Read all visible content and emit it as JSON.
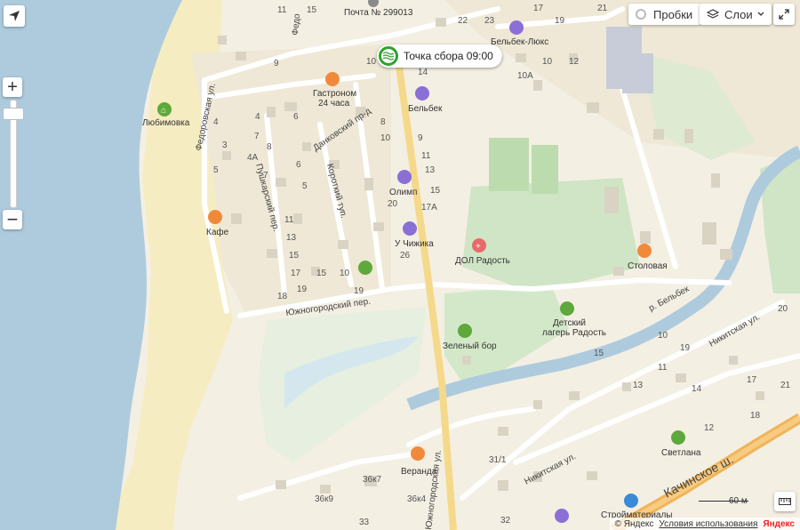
{
  "controls": {
    "traffic_label": "Пробки",
    "layers_label": "Слои",
    "zoom_in": "+",
    "zoom_out": "−"
  },
  "marker": {
    "label": "Точка сбора 09:00",
    "color": "#2fa12f"
  },
  "scale": {
    "label": "60 м"
  },
  "footer": {
    "copyright": "© Яндекс",
    "terms": "Условия использования",
    "logo": "Яндекс"
  },
  "places": {
    "post": "Почта № 299013",
    "lyubimovka": "Любимовка",
    "gastronom": "Гастроном",
    "gastronom_2": "24 часа",
    "belbek_lux": "Бельбек-Люкс",
    "belbek": "Бельбек",
    "olimp": "Олимп",
    "u_chizhika": "У Чижика",
    "dol_radost": "ДОЛ Радость",
    "stolovaya": "Столовая",
    "kafe": "Кафе",
    "zelenyi_bor": "Зеленый бор",
    "detsky_1": "Детский",
    "detsky_2": "лагерь Радость",
    "veranda": "Веранда",
    "svetlana": "Светлана",
    "stroymaterialy": "Стройматериалы"
  },
  "streets": {
    "fedorovskaya": "Федоровская ул.",
    "fedorovskaya_top": "Федо",
    "dankovsky": "Данковский пр-д",
    "pushkarsky": "Пушкарский пер.",
    "korotky": "Короткий туп.",
    "yuzhnogorodsky": "Южногородский пер.",
    "yuzhnogorodskaya": "Южногородская ул.",
    "nikitskaya_1": "Никитская ул.",
    "nikitskaya_2": "Никитская ул.",
    "kachinskoe": "Качинское ш.",
    "river": "р. Бельбек"
  },
  "house_numbers": [
    "11",
    "15",
    "22",
    "23",
    "19",
    "21",
    "17",
    "9",
    "9",
    "10",
    "14",
    "10",
    "12",
    "10А",
    "8",
    "10",
    "9",
    "11",
    "13",
    "15",
    "17А",
    "20",
    "26",
    "4",
    "6",
    "7",
    "8",
    "4",
    "3",
    "5",
    "4А",
    "6",
    "7",
    "5",
    "10",
    "11",
    "13",
    "15",
    "17",
    "18",
    "19",
    "19",
    "15",
    "10",
    "20",
    "19",
    "15",
    "11",
    "13",
    "14",
    "17",
    "18",
    "21",
    "12",
    "31/1",
    "36к7",
    "36к4",
    "36к9",
    "32",
    "33"
  ]
}
